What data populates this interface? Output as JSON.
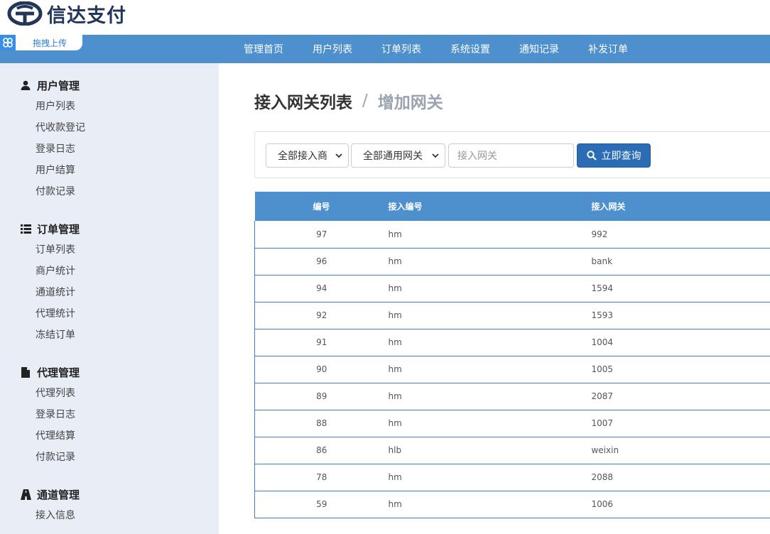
{
  "brand": {
    "name": "信达支付"
  },
  "upload": {
    "label": "拖拽上传",
    "icon": "cloud-link-icon"
  },
  "topnav": {
    "items": [
      "管理首页",
      "用户列表",
      "订单列表",
      "系统设置",
      "通知记录",
      "补发订单"
    ]
  },
  "sidebar": {
    "sections": [
      {
        "title": "用户管理",
        "icon": "user-icon",
        "items": [
          "用户列表",
          "代收款登记",
          "登录日志",
          "用户结算",
          "付款记录"
        ]
      },
      {
        "title": "订单管理",
        "icon": "list-icon",
        "items": [
          "订单列表",
          "商户统计",
          "通道统计",
          "代理统计",
          "冻结订单"
        ]
      },
      {
        "title": "代理管理",
        "icon": "file-icon",
        "items": [
          "代理列表",
          "登录日志",
          "代理结算",
          "付款记录"
        ]
      },
      {
        "title": "通道管理",
        "icon": "road-icon",
        "items": [
          "接入信息"
        ]
      }
    ]
  },
  "page": {
    "title": "接入网关列表",
    "separator": "/",
    "subtitle": "增加网关"
  },
  "filters": {
    "provider_select": "全部接入商",
    "gateway_select": "全部通用网关",
    "gateway_placeholder": "接入网关",
    "query_button": "立即查询"
  },
  "table": {
    "headers": [
      "编号",
      "接入编号",
      "接入网关"
    ],
    "rows": [
      [
        "97",
        "hm",
        "992"
      ],
      [
        "96",
        "hm",
        "bank"
      ],
      [
        "94",
        "hm",
        "1594"
      ],
      [
        "92",
        "hm",
        "1593"
      ],
      [
        "91",
        "hm",
        "1004"
      ],
      [
        "90",
        "hm",
        "1005"
      ],
      [
        "89",
        "hm",
        "2087"
      ],
      [
        "88",
        "hm",
        "1007"
      ],
      [
        "86",
        "hlb",
        "weixin"
      ],
      [
        "78",
        "hm",
        "2088"
      ],
      [
        "59",
        "hm",
        "1006"
      ]
    ]
  },
  "colors": {
    "nav_blue": "#4d90cd",
    "sidebar_bg": "#e9edf6",
    "button_blue": "#2c6cb4",
    "brand_navy": "#22365a"
  }
}
